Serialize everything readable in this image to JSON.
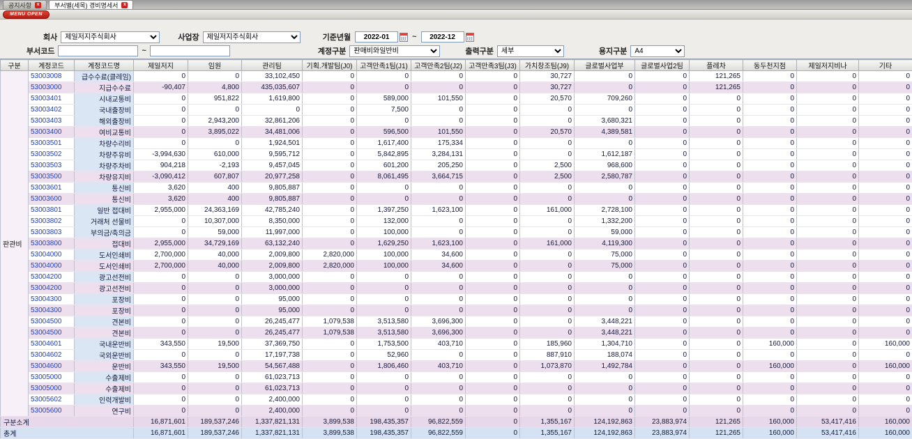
{
  "tabs": [
    {
      "label": "공지사항",
      "active": false
    },
    {
      "label": "부서별(세목) 경비명세서",
      "active": true
    }
  ],
  "menu_open_label": "MENU OPEN",
  "range_separator": "~",
  "filters": {
    "company_label": "회사",
    "company_value": "제일저지주식회사",
    "workplace_label": "사업장",
    "workplace_value": "제일저지주식회사",
    "period_label": "기준년월",
    "period_from": "2022-01",
    "period_to": "2022-12",
    "dept_code_label": "부서코드",
    "dept_code_from": "",
    "dept_code_to": "",
    "account_type_label": "계정구분",
    "account_type_value": "판매비와일반비",
    "output_type_label": "출력구분",
    "output_type_value": "세부",
    "paper_type_label": "용지구분",
    "paper_type_value": "A4"
  },
  "table": {
    "columns": [
      "구분",
      "계정코드",
      "계정코드명",
      "제일저지",
      "임원",
      "관리팀",
      "기획.개발팀(J0)",
      "고객만족1팀(J1)",
      "고객만족2팀(J2)",
      "고객만족3팀(J3)",
      "가치창조팀(J9)",
      "글로벌사업부",
      "글로벌사업2팀",
      "플레차",
      "동두천지점",
      "제일저지비나",
      "기타"
    ],
    "group_label": "판관비",
    "rows": [
      {
        "code": "53003008",
        "name": "급수수료(클레임)",
        "type": "detail",
        "values": [
          "0",
          "0",
          "33,102,450",
          "0",
          "0",
          "0",
          "0",
          "30,727",
          "0",
          "0",
          "121,265",
          "0",
          "0",
          "0"
        ]
      },
      {
        "code": "53003000",
        "name": "지급수수료",
        "type": "summary",
        "values": [
          "-90,407",
          "4,800",
          "435,035,607",
          "0",
          "0",
          "0",
          "0",
          "30,727",
          "0",
          "0",
          "121,265",
          "0",
          "0",
          "0"
        ]
      },
      {
        "code": "53003401",
        "name": "시내교통비",
        "type": "detail",
        "values": [
          "0",
          "951,822",
          "1,619,800",
          "0",
          "589,000",
          "101,550",
          "0",
          "20,570",
          "709,260",
          "0",
          "0",
          "0",
          "0",
          "0"
        ]
      },
      {
        "code": "53003402",
        "name": "국내출장비",
        "type": "detail",
        "values": [
          "0",
          "0",
          "0",
          "0",
          "7,500",
          "0",
          "0",
          "0",
          "0",
          "0",
          "0",
          "0",
          "0",
          "0"
        ]
      },
      {
        "code": "53003403",
        "name": "해외출장비",
        "type": "detail",
        "values": [
          "0",
          "2,943,200",
          "32,861,206",
          "0",
          "0",
          "0",
          "0",
          "0",
          "3,680,321",
          "0",
          "0",
          "0",
          "0",
          "0"
        ]
      },
      {
        "code": "53003400",
        "name": "여비교통비",
        "type": "summary",
        "values": [
          "0",
          "3,895,022",
          "34,481,006",
          "0",
          "596,500",
          "101,550",
          "0",
          "20,570",
          "4,389,581",
          "0",
          "0",
          "0",
          "0",
          "0"
        ]
      },
      {
        "code": "53003501",
        "name": "차량수리비",
        "type": "detail",
        "values": [
          "0",
          "0",
          "1,924,501",
          "0",
          "1,617,400",
          "175,334",
          "0",
          "0",
          "0",
          "0",
          "0",
          "0",
          "0",
          "0"
        ]
      },
      {
        "code": "53003502",
        "name": "차량주유비",
        "type": "detail",
        "values": [
          "-3,994,630",
          "610,000",
          "9,595,712",
          "0",
          "5,842,895",
          "3,284,131",
          "0",
          "0",
          "1,612,187",
          "0",
          "0",
          "0",
          "0",
          "0"
        ]
      },
      {
        "code": "53003503",
        "name": "차량주차비",
        "type": "detail",
        "values": [
          "904,218",
          "-2,193",
          "9,457,045",
          "0",
          "601,200",
          "205,250",
          "0",
          "2,500",
          "968,600",
          "0",
          "0",
          "0",
          "0",
          "0"
        ]
      },
      {
        "code": "53003500",
        "name": "차량유지비",
        "type": "summary",
        "values": [
          "-3,090,412",
          "607,807",
          "20,977,258",
          "0",
          "8,061,495",
          "3,664,715",
          "0",
          "2,500",
          "2,580,787",
          "0",
          "0",
          "0",
          "0",
          "0"
        ]
      },
      {
        "code": "53003601",
        "name": "통신비",
        "type": "detail",
        "values": [
          "3,620",
          "400",
          "9,805,887",
          "0",
          "0",
          "0",
          "0",
          "0",
          "0",
          "0",
          "0",
          "0",
          "0",
          "0"
        ]
      },
      {
        "code": "53003600",
        "name": "통신비",
        "type": "summary",
        "values": [
          "3,620",
          "400",
          "9,805,887",
          "0",
          "0",
          "0",
          "0",
          "0",
          "0",
          "0",
          "0",
          "0",
          "0",
          "0"
        ]
      },
      {
        "code": "53003801",
        "name": "일반 접대비",
        "type": "detail",
        "values": [
          "2,955,000",
          "24,363,169",
          "42,785,240",
          "0",
          "1,397,250",
          "1,623,100",
          "0",
          "161,000",
          "2,728,100",
          "0",
          "0",
          "0",
          "0",
          "0"
        ]
      },
      {
        "code": "53003802",
        "name": "거래처 선물비",
        "type": "detail",
        "values": [
          "0",
          "10,307,000",
          "8,350,000",
          "0",
          "132,000",
          "0",
          "0",
          "0",
          "1,332,200",
          "0",
          "0",
          "0",
          "0",
          "0"
        ]
      },
      {
        "code": "53003803",
        "name": "부의금/축의금",
        "type": "detail",
        "values": [
          "0",
          "59,000",
          "11,997,000",
          "0",
          "100,000",
          "0",
          "0",
          "0",
          "59,000",
          "0",
          "0",
          "0",
          "0",
          "0"
        ]
      },
      {
        "code": "53003800",
        "name": "접대비",
        "type": "summary",
        "values": [
          "2,955,000",
          "34,729,169",
          "63,132,240",
          "0",
          "1,629,250",
          "1,623,100",
          "0",
          "161,000",
          "4,119,300",
          "0",
          "0",
          "0",
          "0",
          "0"
        ]
      },
      {
        "code": "53004000",
        "name": "도서인쇄비",
        "type": "detail",
        "values": [
          "2,700,000",
          "40,000",
          "2,009,800",
          "2,820,000",
          "100,000",
          "34,600",
          "0",
          "0",
          "75,000",
          "0",
          "0",
          "0",
          "0",
          "0"
        ]
      },
      {
        "code": "53004000",
        "name": "도서인쇄비",
        "type": "summary",
        "values": [
          "2,700,000",
          "40,000",
          "2,009,800",
          "2,820,000",
          "100,000",
          "34,600",
          "0",
          "0",
          "75,000",
          "0",
          "0",
          "0",
          "0",
          "0"
        ]
      },
      {
        "code": "53004200",
        "name": "광고선전비",
        "type": "detail",
        "values": [
          "0",
          "0",
          "3,000,000",
          "0",
          "0",
          "0",
          "0",
          "0",
          "0",
          "0",
          "0",
          "0",
          "0",
          "0"
        ]
      },
      {
        "code": "53004200",
        "name": "광고선전비",
        "type": "summary",
        "values": [
          "0",
          "0",
          "3,000,000",
          "0",
          "0",
          "0",
          "0",
          "0",
          "0",
          "0",
          "0",
          "0",
          "0",
          "0"
        ]
      },
      {
        "code": "53004300",
        "name": "포장비",
        "type": "detail",
        "values": [
          "0",
          "0",
          "95,000",
          "0",
          "0",
          "0",
          "0",
          "0",
          "0",
          "0",
          "0",
          "0",
          "0",
          "0"
        ]
      },
      {
        "code": "53004300",
        "name": "포장비",
        "type": "summary",
        "values": [
          "0",
          "0",
          "95,000",
          "0",
          "0",
          "0",
          "0",
          "0",
          "0",
          "0",
          "0",
          "0",
          "0",
          "0"
        ]
      },
      {
        "code": "53004500",
        "name": "견본비",
        "type": "detail",
        "values": [
          "0",
          "0",
          "26,245,477",
          "1,079,538",
          "3,513,580",
          "3,696,300",
          "0",
          "0",
          "3,448,221",
          "0",
          "0",
          "0",
          "0",
          "0"
        ]
      },
      {
        "code": "53004500",
        "name": "견본비",
        "type": "summary",
        "values": [
          "0",
          "0",
          "26,245,477",
          "1,079,538",
          "3,513,580",
          "3,696,300",
          "0",
          "0",
          "3,448,221",
          "0",
          "0",
          "0",
          "0",
          "0"
        ]
      },
      {
        "code": "53004601",
        "name": "국내운반비",
        "type": "detail",
        "values": [
          "343,550",
          "19,500",
          "37,369,750",
          "0",
          "1,753,500",
          "403,710",
          "0",
          "185,960",
          "1,304,710",
          "0",
          "0",
          "160,000",
          "0",
          "160,000"
        ]
      },
      {
        "code": "53004602",
        "name": "국외운반비",
        "type": "detail",
        "values": [
          "0",
          "0",
          "17,197,738",
          "0",
          "52,960",
          "0",
          "0",
          "887,910",
          "188,074",
          "0",
          "0",
          "0",
          "0",
          "0"
        ]
      },
      {
        "code": "53004600",
        "name": "운반비",
        "type": "summary",
        "values": [
          "343,550",
          "19,500",
          "54,567,488",
          "0",
          "1,806,460",
          "403,710",
          "0",
          "1,073,870",
          "1,492,784",
          "0",
          "0",
          "160,000",
          "0",
          "160,000"
        ]
      },
      {
        "code": "53005000",
        "name": "수출제비",
        "type": "detail",
        "values": [
          "0",
          "0",
          "61,023,713",
          "0",
          "0",
          "0",
          "0",
          "0",
          "0",
          "0",
          "0",
          "0",
          "0",
          "0"
        ]
      },
      {
        "code": "53005000",
        "name": "수출제비",
        "type": "summary",
        "values": [
          "0",
          "0",
          "61,023,713",
          "0",
          "0",
          "0",
          "0",
          "0",
          "0",
          "0",
          "0",
          "0",
          "0",
          "0"
        ]
      },
      {
        "code": "53005602",
        "name": "인력개발비",
        "type": "detail",
        "values": [
          "0",
          "0",
          "2,400,000",
          "0",
          "0",
          "0",
          "0",
          "0",
          "0",
          "0",
          "0",
          "0",
          "0",
          "0"
        ]
      },
      {
        "code": "53005600",
        "name": "연구비",
        "type": "summary",
        "values": [
          "0",
          "0",
          "2,400,000",
          "0",
          "0",
          "0",
          "0",
          "0",
          "0",
          "0",
          "0",
          "0",
          "0",
          "0"
        ]
      }
    ],
    "subtotal": {
      "label": "구분소계",
      "values": [
        "16,871,601",
        "189,537,246",
        "1,337,821,131",
        "3,899,538",
        "198,435,357",
        "96,822,559",
        "0",
        "1,355,167",
        "124,192,863",
        "23,883,974",
        "121,265",
        "160,000",
        "53,417,416",
        "160,000"
      ]
    },
    "total": {
      "label": "총계",
      "values": [
        "16,871,601",
        "189,537,246",
        "1,337,821,131",
        "3,899,538",
        "198,435,357",
        "96,822,559",
        "0",
        "1,355,167",
        "124,192,863",
        "23,883,974",
        "121,265",
        "160,000",
        "53,417,416",
        "160,000"
      ]
    }
  }
}
